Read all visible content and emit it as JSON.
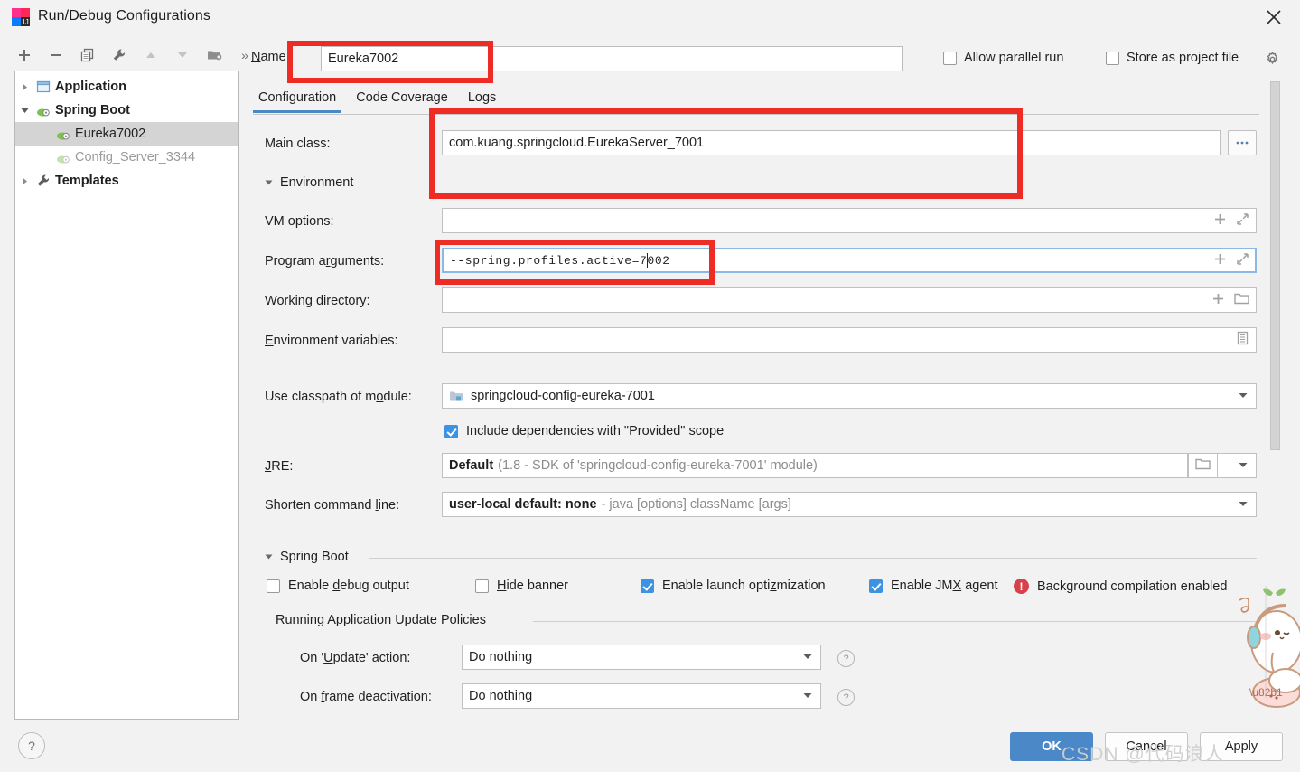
{
  "window": {
    "title": "Run/Debug Configurations",
    "app_icon": "intellij-idea-icon",
    "close_icon": "close-icon"
  },
  "toolbar": {
    "buttons": [
      {
        "name": "add-configuration-button",
        "icon": "plus-icon",
        "glyph": "+"
      },
      {
        "name": "remove-configuration-button",
        "icon": "minus-icon",
        "glyph": "−"
      },
      {
        "name": "copy-configuration-button",
        "icon": "copy-icon",
        "glyph": "❐"
      },
      {
        "name": "edit-templates-button",
        "icon": "wrench-icon",
        "glyph": "🔧"
      },
      {
        "name": "move-up-button",
        "icon": "arrow-up-icon",
        "glyph": "▲"
      },
      {
        "name": "move-down-button",
        "icon": "arrow-down-icon",
        "glyph": "▼"
      },
      {
        "name": "new-folder-button",
        "icon": "folder-add-icon",
        "glyph": "📁"
      },
      {
        "name": "more-actions-button",
        "icon": "chevron-double-right-icon",
        "glyph": "»"
      }
    ]
  },
  "tree": {
    "items": [
      {
        "label": "Application",
        "icon": "application-icon",
        "arrow": "collapsed",
        "bold": true,
        "selected": false,
        "dim": false,
        "indent": 0
      },
      {
        "label": "Spring Boot",
        "icon": "spring-boot-icon",
        "arrow": "expanded",
        "bold": true,
        "selected": false,
        "dim": false,
        "indent": 0
      },
      {
        "label": "Eureka7002",
        "icon": "spring-boot-icon",
        "arrow": "none",
        "bold": false,
        "selected": true,
        "dim": false,
        "indent": 1
      },
      {
        "label": "Config_Server_3344",
        "icon": "spring-boot-icon",
        "arrow": "none",
        "bold": false,
        "selected": false,
        "dim": true,
        "indent": 1
      },
      {
        "label": "Templates",
        "icon": "wrench-icon",
        "arrow": "collapsed",
        "bold": true,
        "selected": false,
        "dim": false,
        "indent": 0
      }
    ]
  },
  "header": {
    "name_label": "Name:",
    "name_value": "Eureka7002",
    "allow_parallel_run": {
      "label": "Allow parallel run",
      "checked": false
    },
    "store_as_project_file": {
      "label": "Store as project file",
      "checked": false,
      "gear_icon": "gear-icon"
    }
  },
  "tabs": [
    {
      "label": "Configuration",
      "active": true
    },
    {
      "label": "Code Coverage",
      "active": false
    },
    {
      "label": "Logs",
      "active": false
    }
  ],
  "form": {
    "main_class": {
      "label": "Main class:",
      "value": "com.kuang.springcloud.EurekaServer_7001",
      "browse_button": "ellipsis-button",
      "browse_label": "..."
    },
    "environment_section": {
      "label": "Environment",
      "expanded": true
    },
    "vm_options": {
      "label": "VM options:",
      "value": "",
      "expand_icon": "expand-icon",
      "macro_icon": "plus-icon"
    },
    "program_arguments": {
      "label": "Program arguments:",
      "value": "--spring.profiles.active=7002",
      "caret_after": "--spring.profiles.active=7",
      "caret_before_rest": "002",
      "focused": true,
      "expand_icon": "expand-icon",
      "macro_icon": "plus-icon"
    },
    "working_directory": {
      "label": "Working directory:",
      "value": "",
      "browse_icon": "folder-icon",
      "macro_icon": "plus-icon"
    },
    "environment_variables": {
      "label": "Environment variables:",
      "value": "",
      "browse_icon": "list-icon"
    },
    "classpath_module": {
      "label": "Use classpath of module:",
      "value": "springcloud-config-eureka-7001",
      "icon": "module-icon",
      "caret_icon": "chevron-down-icon"
    },
    "include_provided": {
      "label": "Include dependencies with \"Provided\" scope",
      "checked": true
    },
    "jre": {
      "label": "JRE:",
      "value_bold": "Default",
      "value_dim": "(1.8 - SDK of 'springcloud-config-eureka-7001' module)",
      "browse_icon": "folder-icon",
      "caret_icon": "chevron-down-icon"
    },
    "shorten_command_line": {
      "label": "Shorten command line:",
      "value_bold": "user-local default: none",
      "value_dim": "- java [options] className [args]",
      "caret_icon": "chevron-down-icon"
    },
    "spring_boot_section": {
      "label": "Spring Boot",
      "expanded": true
    },
    "spring_boot_checks": [
      {
        "label": "Enable debug output",
        "checked": false,
        "name": "enable-debug-output-checkbox"
      },
      {
        "label": "Hide banner",
        "checked": false,
        "name": "hide-banner-checkbox"
      },
      {
        "label": "Enable launch optimization",
        "checked": true,
        "name": "enable-launch-optimization-checkbox"
      },
      {
        "label": "Enable JMX agent",
        "checked": true,
        "name": "enable-jmx-agent-checkbox"
      }
    ],
    "background_compilation": {
      "label": "Background compilation enabled",
      "icon": "error-icon",
      "glyph": "!"
    },
    "update_policies_section": {
      "label": "Running Application Update Policies"
    },
    "on_update_action": {
      "label": "On 'Update' action:",
      "value": "Do nothing",
      "help_icon": "help-icon",
      "help_glyph": "?"
    },
    "on_frame_deactivation": {
      "label": "On frame deactivation:",
      "value": "Do nothing",
      "help_icon": "help-icon",
      "help_glyph": "?"
    }
  },
  "footer": {
    "help_button": {
      "name": "help-button",
      "glyph": "?"
    },
    "ok": "OK",
    "cancel": "Cancel",
    "apply": "Apply"
  },
  "overlay": {
    "watermark": "CSDN @代码浪人",
    "annotation_color": "#ee2b24",
    "sticker": "rabbit-sticker"
  },
  "colors": {
    "accent": "#4a88c7",
    "selection": "#d4d4d4",
    "checkbox_on": "#3c92e3",
    "error": "#d9414a",
    "annotation": "#ee2b24"
  }
}
